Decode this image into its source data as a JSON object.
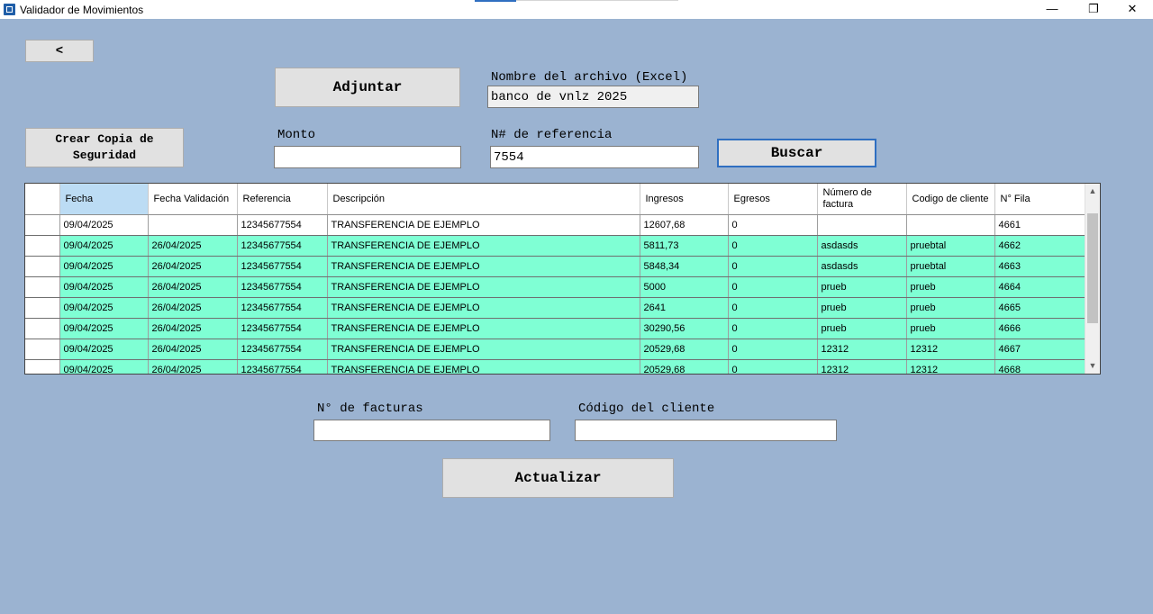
{
  "window": {
    "title": "Validador de Movimientos",
    "minimize_icon": "minimize-icon",
    "maximize_icon": "restore-icon",
    "close_icon": "close-icon"
  },
  "back_button": {
    "label": "<"
  },
  "attach_button": {
    "label": "Adjuntar"
  },
  "file_name": {
    "label": "Nombre del archivo (Excel)",
    "value": "banco de vnlz 2025"
  },
  "backup_button": {
    "label": "Crear Copia de Seguridad"
  },
  "amount": {
    "label": "Monto",
    "value": ""
  },
  "reference": {
    "label": "N# de referencia",
    "value": "7554"
  },
  "search_button": {
    "label": "Buscar"
  },
  "table": {
    "columns": [
      "Fecha",
      "Fecha Validación",
      "Referencia",
      "Descripción",
      "Ingresos",
      "Egresos",
      "Número de factura",
      "Codigo de cliente",
      "N° Fila"
    ],
    "rows": [
      [
        "09/04/2025",
        "",
        "12345677554",
        "TRANSFERENCIA DE EJEMPLO",
        "12607,68",
        "0",
        "",
        "",
        "4661"
      ],
      [
        "09/04/2025",
        "26/04/2025",
        "12345677554",
        "TRANSFERENCIA DE EJEMPLO",
        "5811,73",
        "0",
        "asdasds",
        "pruebtal",
        "4662"
      ],
      [
        "09/04/2025",
        "26/04/2025",
        "12345677554",
        "TRANSFERENCIA DE EJEMPLO",
        "5848,34",
        "0",
        "asdasds",
        "pruebtal",
        "4663"
      ],
      [
        "09/04/2025",
        "26/04/2025",
        "12345677554",
        "TRANSFERENCIA DE EJEMPLO",
        "5000",
        "0",
        "prueb",
        "prueb",
        "4664"
      ],
      [
        "09/04/2025",
        "26/04/2025",
        "12345677554",
        "TRANSFERENCIA DE EJEMPLO",
        "2641",
        "0",
        "prueb",
        "prueb",
        "4665"
      ],
      [
        "09/04/2025",
        "26/04/2025",
        "12345677554",
        "TRANSFERENCIA DE EJEMPLO",
        "30290,56",
        "0",
        "prueb",
        "prueb",
        "4666"
      ],
      [
        "09/04/2025",
        "26/04/2025",
        "12345677554",
        "TRANSFERENCIA DE EJEMPLO",
        "20529,68",
        "0",
        "12312",
        "12312",
        "4667"
      ],
      [
        "09/04/2025",
        "26/04/2025",
        "12345677554",
        "TRANSFERENCIA DE EJEMPLO",
        "20529,68",
        "0",
        "12312",
        "12312",
        "4668"
      ]
    ],
    "row_highlight_color": "#7fffd4",
    "selected_header_color": "#bcdcf4"
  },
  "invoices": {
    "label": "N° de facturas",
    "value": ""
  },
  "client_code": {
    "label": "Código del cliente",
    "value": ""
  },
  "update_button": {
    "label": "Actualizar"
  },
  "colors": {
    "background": "#9bb3d1",
    "button": "#e1e1e1",
    "accent_border": "#2f6fc1"
  }
}
